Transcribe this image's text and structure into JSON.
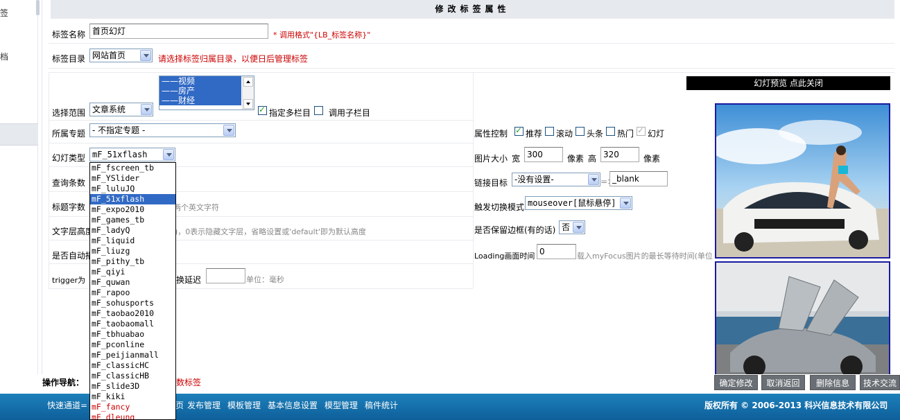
{
  "left_nav": {
    "items": [
      "签",
      "档"
    ]
  },
  "form": {
    "title": "修改标签属性",
    "name": {
      "label": "标签名称",
      "value": "首页幻灯",
      "hint": "* 调用格式\"{LB_标签名称}\""
    },
    "dir": {
      "label": "标签目录",
      "value": "网站首页",
      "hint": "请选择标签归属目录，以便日后管理标签"
    },
    "scope": {
      "label": "选择范围",
      "value": "文章系统",
      "columns": [
        "——视频",
        "——房产",
        "——财经"
      ],
      "multi_label": "指定多栏目",
      "sub_label": "调用子栏目"
    },
    "topic": {
      "label": "所属专题",
      "value": "- 不指定专题 -"
    },
    "flash_type": {
      "label": "幻灯类型",
      "value": "mF_51xflash",
      "options": [
        "mF_fscreen_tb",
        "mF_YSlider",
        "mF_luluJQ",
        "mF_51xflash",
        "mF_expo2010",
        "mF_games_tb",
        "mF_ladyQ",
        "mF_liquid",
        "mF_liuzg",
        "mF_pithy_tb",
        "mF_qiyi",
        "mF_quwan",
        "mF_rapoo",
        "mF_sohusports",
        "mF_taobao2010",
        "mF_taobaomall",
        "mF_tbhuabao",
        "mF_pconline",
        "mF_peijianmall",
        "mF_classicHC",
        "mF_classicHB",
        "mF_slide3D",
        "mF_kiki",
        "mF_fancy",
        "mF_dleung"
      ],
      "selected_index": 3,
      "red_options": [
        23,
        24
      ]
    },
    "query_count": {
      "label": "查询条数"
    },
    "title_chars": {
      "label": "标题字数",
      "hint": "两个英文字符"
    },
    "text_height": {
      "label": "文字层高度",
      "hint": ")，0表示隐藏文字层，省略设置或'default'即为默认高度"
    },
    "auto_play": {
      "label": "是否自动播"
    },
    "trigger": {
      "label": "trigger为",
      "delay_label": "换延迟",
      "delay_value": "",
      "delay_unit": "单位：毫秒"
    },
    "attr": {
      "label": "属性控制",
      "items": [
        {
          "name": "推荐",
          "checked": true
        },
        {
          "name": "滚动",
          "checked": false
        },
        {
          "name": "头条",
          "checked": false
        },
        {
          "name": "热门",
          "checked": false
        },
        {
          "name": "幻灯",
          "checked": true,
          "disabled": true
        }
      ]
    },
    "size": {
      "label": "图片大小",
      "w_label": "宽",
      "w_value": "300",
      "unit": "像素",
      "h_label": "高",
      "h_value": "320"
    },
    "link": {
      "label": "链接目标",
      "value": "-没有设置-",
      "arrow": "=>",
      "target": "_blank"
    },
    "trigger_mode": {
      "label": "触发切换模式",
      "value": "mouseover[鼠标悬停]"
    },
    "border": {
      "label": "是否保留边框(有的话)",
      "value": "否"
    },
    "loading": {
      "label": "Loading画面时间",
      "value": "0",
      "hint": "载入myFocus图片的最长等待时间(单位"
    }
  },
  "preview": {
    "title": "幻灯预览 点此关闭"
  },
  "nav": {
    "label": "操作导航：",
    "partial": "数标签"
  },
  "buttons": [
    "确定修改",
    "取消返回",
    "删除信息",
    "技术交流"
  ],
  "footer": {
    "quick": "快速通道=",
    "links": [
      "页",
      "发布管理",
      "模板管理",
      "基本信息设置",
      "模型管理",
      "稿件统计"
    ],
    "copyright": "版权所有 © 2006-2013 科兴信息技术有限公司"
  },
  "colors": {
    "select_blue": "#316ac5",
    "footer_blue": "#1577b2",
    "hint_red": "#cc0000",
    "preview_border": "#1a1aa0"
  }
}
